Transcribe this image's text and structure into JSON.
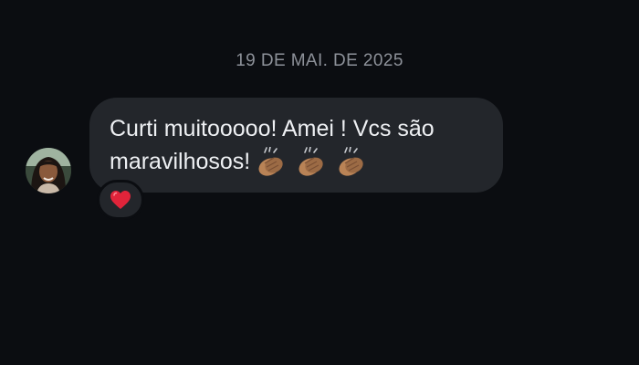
{
  "chat": {
    "date_separator": "19 DE MAI. DE 2025",
    "message": {
      "text": "Curti muitooooo! Amei ! Vcs são maravilhosos!",
      "emojis": [
        "clapping-hands-medium-skin",
        "clapping-hands-medium-skin",
        "clapping-hands-medium-skin"
      ],
      "reactions": [
        "red-heart"
      ]
    }
  },
  "colors": {
    "background": "#0b0d11",
    "bubble": "#23262b",
    "message_text": "#eef0f3",
    "date_text": "#8d9199",
    "heart": "#e0243a",
    "clap_skin": "#b98356"
  }
}
